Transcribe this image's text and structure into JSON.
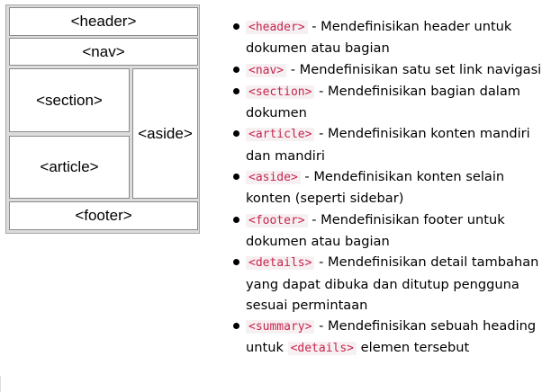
{
  "diagram": {
    "header": "<header>",
    "nav": "<nav>",
    "section": "<section>",
    "article": "<article>",
    "aside": "<aside>",
    "footer": "<footer>"
  },
  "items": [
    {
      "tag": "<header>",
      "desc": " - Mendefinisikan header untuk dokumen atau bagian"
    },
    {
      "tag": "<nav>",
      "desc": " - Mendefinisikan satu set link navigasi"
    },
    {
      "tag": "<section>",
      "desc": " - Mendefinisikan bagian dalam dokumen"
    },
    {
      "tag": "<article>",
      "desc": " - Mendefinisikan konten mandiri dan mandiri"
    },
    {
      "tag": "<aside>",
      "desc": " - Mendefinisikan konten selain konten (seperti sidebar)"
    },
    {
      "tag": "<footer>",
      "desc": " - Mendefinisikan footer untuk dokumen atau bagian"
    },
    {
      "tag": "<details>",
      "desc": " - Mendefinisikan detail tambahan yang dapat dibuka dan ditutup pengguna sesuai permintaan"
    },
    {
      "tag": "<summary>",
      "desc": " - Mendefinisikan sebuah heading untuk ",
      "tag2": "<details>",
      "desc2": " elemen tersebut"
    }
  ]
}
